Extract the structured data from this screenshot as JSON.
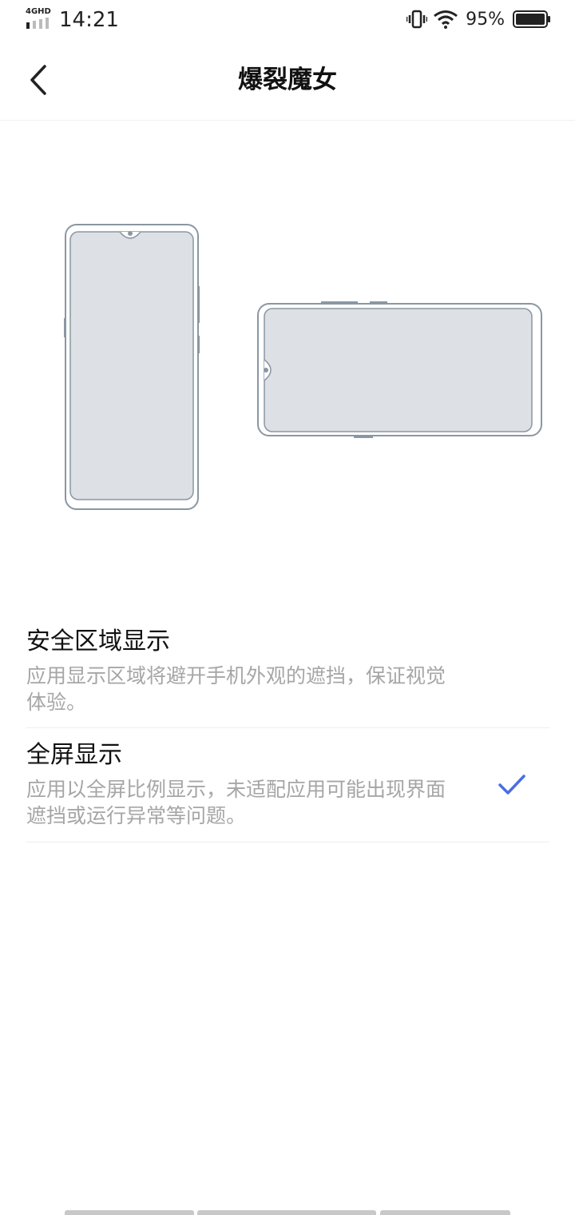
{
  "status_bar": {
    "network": "4GHD",
    "time": "14:21",
    "battery_percent": "95%",
    "icons": [
      "signal-icon",
      "vibrate-icon",
      "wifi-icon",
      "battery-icon"
    ]
  },
  "header": {
    "title": "爆裂魔女",
    "back_icon": "back-arrow-icon"
  },
  "options": [
    {
      "title": "安全区域显示",
      "description": "应用显示区域将避开手机外观的遮挡，保证视觉体验。",
      "selected": false
    },
    {
      "title": "全屏显示",
      "description": "应用以全屏比例显示，未适配应用可能出现界面遮挡或运行异常等问题。",
      "selected": true
    }
  ],
  "colors": {
    "accent": "#4a6ee0",
    "illustration_fill": "#dde0e5",
    "illustration_stroke": "#8a97a3",
    "secondary_text": "#a6a6a6"
  }
}
